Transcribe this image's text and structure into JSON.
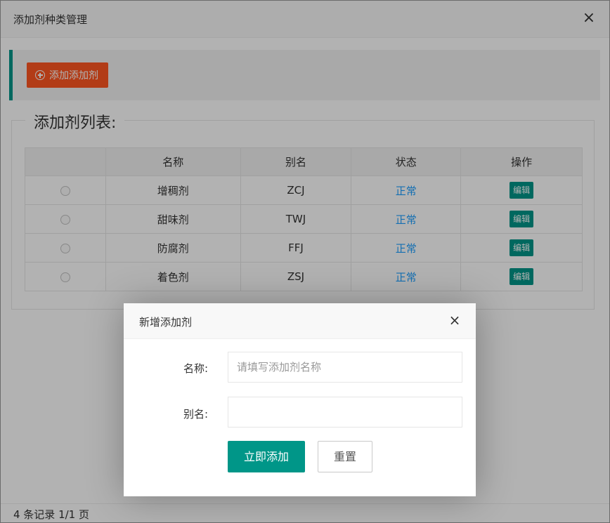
{
  "window": {
    "title": "添加剂种类管理",
    "close_icon": "×"
  },
  "toolbar": {
    "add_button_label": "添加添加剂",
    "add_icon": "plus-circle-icon"
  },
  "list": {
    "legend": "添加剂列表:",
    "columns": [
      "",
      "名称",
      "别名",
      "状态",
      "操作"
    ],
    "rows": [
      {
        "name": "增稠剂",
        "alias": "ZCJ",
        "status": "正常",
        "action": "编辑"
      },
      {
        "name": "甜味剂",
        "alias": "TWJ",
        "status": "正常",
        "action": "编辑"
      },
      {
        "name": "防腐剂",
        "alias": "FFJ",
        "status": "正常",
        "action": "编辑"
      },
      {
        "name": "着色剂",
        "alias": "ZSJ",
        "status": "正常",
        "action": "编辑"
      }
    ]
  },
  "footer": {
    "pagination_text": "4 条记录 1/1 页"
  },
  "dialog": {
    "title": "新增添加剂",
    "close_icon": "×",
    "name_label": "名称:",
    "name_placeholder": "请填写添加剂名称",
    "name_value": "",
    "alias_label": "别名:",
    "alias_value": "",
    "submit_label": "立即添加",
    "reset_label": "重置"
  },
  "colors": {
    "primary": "#009688",
    "warm": "#FF5722",
    "status": "#1E9FFF"
  }
}
